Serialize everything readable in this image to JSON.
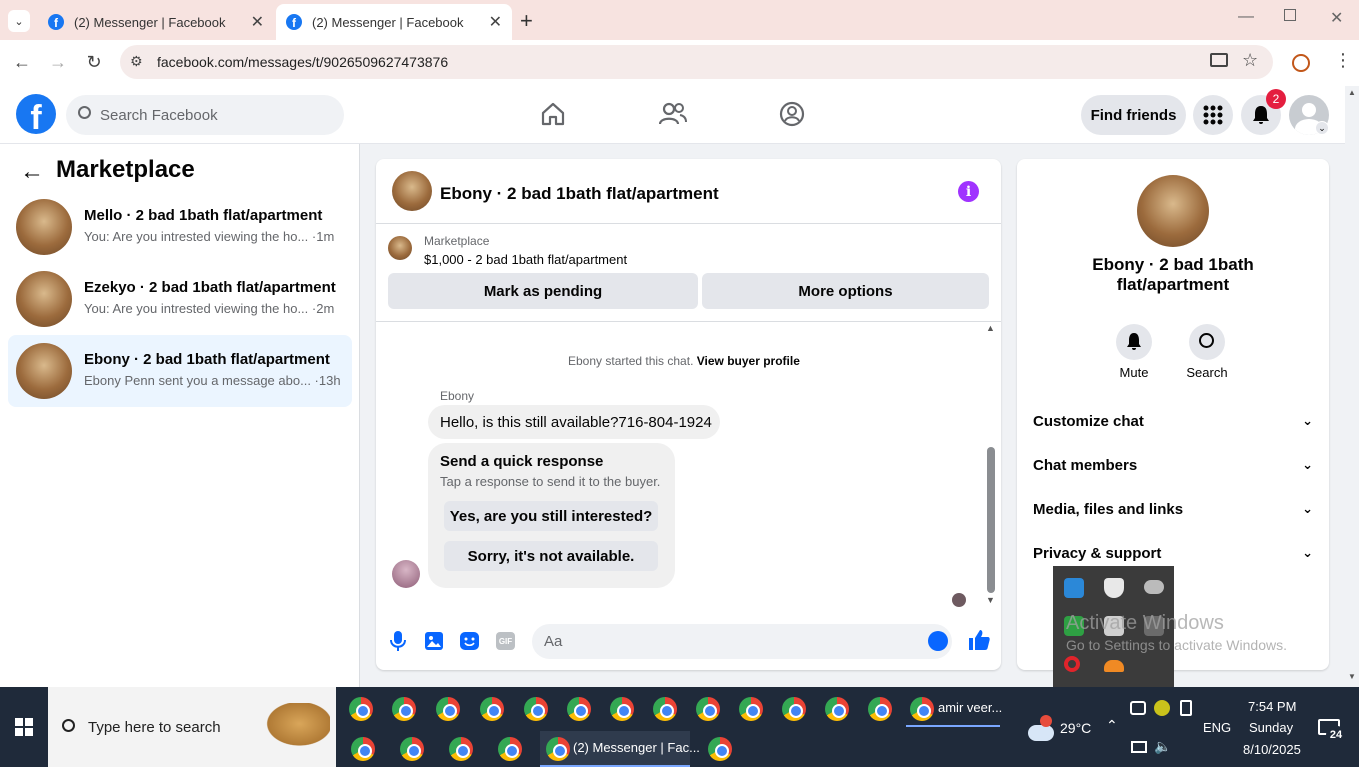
{
  "browser": {
    "tabs": [
      {
        "title": "(2) Messenger | Facebook"
      },
      {
        "title": "(2) Messenger | Facebook"
      }
    ],
    "url": "facebook.com/messages/t/9026509627473876"
  },
  "header": {
    "logo": "f",
    "search_placeholder": "Search Facebook",
    "find_friends": "Find friends",
    "notifications_count": "2"
  },
  "sidebar": {
    "title": "Marketplace",
    "conversations": [
      {
        "title": "Mello · 2 bad 1bath flat/apartment",
        "preview": "You: Are you intrested viewing the ho... ·1m"
      },
      {
        "title": "Ezekyo · 2 bad 1bath flat/apartment",
        "preview": "You: Are you intrested viewing the ho... ·2m"
      },
      {
        "title": "Ebony · 2 bad 1bath flat/apartment",
        "preview": "Ebony Penn sent you a message abo... ·13h"
      }
    ]
  },
  "chat": {
    "title": "Ebony · 2 bad 1bath flat/apartment",
    "listing_label": "Marketplace",
    "listing_detail": "$1,000 - 2 bad 1bath flat/apartment",
    "mark_pending": "Mark as pending",
    "more_options": "More options",
    "system_msg": "Ebony started this chat.",
    "view_buyer": "View buyer profile",
    "sender_name": "Ebony",
    "message": "Hello, is this still available?716-804-1924",
    "quick_title": "Send a quick response",
    "quick_sub": "Tap a response to send it to the buyer.",
    "quick_responses": [
      "Yes, are you still interested?",
      "Sorry, it's not available."
    ],
    "composer_placeholder": "Aa"
  },
  "details": {
    "title": "Ebony · 2 bad 1bath flat/apartment",
    "mute": "Mute",
    "search": "Search",
    "sections": [
      "Customize chat",
      "Chat members",
      "Media, files and links",
      "Privacy & support"
    ]
  },
  "watermark": {
    "line1": "Activate Windows",
    "line2": "Go to Settings to activate Windows."
  },
  "taskbar": {
    "search_placeholder": "Type here to search",
    "app_label_1": "amir veer...",
    "app_label_2": "(2) Messenger | Fac...",
    "weather": "29°C",
    "lang": "ENG",
    "time": "7:54 PM",
    "day": "Sunday",
    "date": "8/10/2025",
    "notif_count": "24"
  },
  "colors": {
    "fb_blue": "#1877f2",
    "messenger_purple": "#a033ff"
  }
}
